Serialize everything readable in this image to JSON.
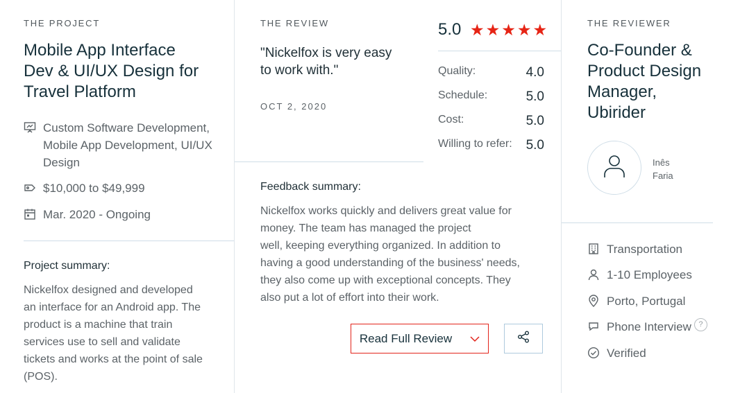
{
  "project": {
    "eyebrow": "THE PROJECT",
    "title_lines": [
      "Mobile App Interface",
      "Dev & UI/UX Design for",
      "Travel Platform"
    ],
    "services_lines": [
      "Custom Software Development,",
      "Mobile App Development, UI/UX",
      "Design"
    ],
    "budget": "$10,000 to $49,999",
    "timeline": "Mar. 2020 - Ongoing",
    "summary_label": "Project summary:",
    "summary_lines": [
      "Nickelfox designed and developed",
      "an interface for an Android app. The",
      "product is a machine that train",
      "services use to sell and validate",
      "tickets and works at the point of sale",
      "(POS)."
    ]
  },
  "review": {
    "eyebrow": "THE REVIEW",
    "quote_lines": [
      "\"Nickelfox is very easy",
      "to work with.\""
    ],
    "date": "OCT 2, 2020",
    "overall": "5.0",
    "stars": [
      "★",
      "★",
      "★",
      "★",
      "★"
    ],
    "ratings": [
      {
        "label": "Quality:",
        "value": "4.0"
      },
      {
        "label": "Schedule:",
        "value": "5.0"
      },
      {
        "label": "Cost:",
        "value": "5.0"
      },
      {
        "label": "Willing to refer:",
        "value": "5.0"
      }
    ],
    "feedback_label": "Feedback summary:",
    "feedback_lines": [
      "Nickelfox works quickly and delivers great value for",
      "money. The team has managed the project",
      "well, keeping everything organized. In addition to",
      "having a good understanding of the business' needs,",
      "they also come up with exceptional concepts. They",
      "also put a lot of effort into their work."
    ],
    "read_full_label": "Read Full Review"
  },
  "reviewer": {
    "eyebrow": "THE REVIEWER",
    "title_lines": [
      "Co-Founder &",
      "Product Design",
      "Manager,",
      "Ubirider"
    ],
    "name_lines": [
      "Inês",
      "Faria"
    ],
    "industry": "Transportation",
    "size": "1-10 Employees",
    "location": "Porto, Portugal",
    "interview": "Phone Interview",
    "help_glyph": "?",
    "verified": "Verified"
  },
  "colors": {
    "accent": "#e2231a",
    "star": "#e62415",
    "divider": "#cfdde7",
    "heading": "#17313b"
  }
}
